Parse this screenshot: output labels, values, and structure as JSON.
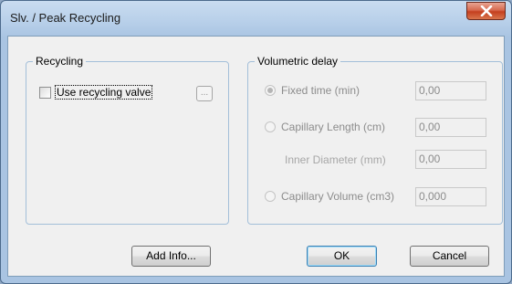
{
  "window": {
    "title": "Slv. / Peak Recycling"
  },
  "recycling": {
    "group_label": "Recycling",
    "checkbox_label": "Use recycling valve",
    "checkbox_checked": false,
    "browse_label": "..."
  },
  "volumetric": {
    "group_label": "Volumetric delay",
    "options": [
      {
        "label": "Fixed time (min)",
        "value": "0,00",
        "checked": true
      },
      {
        "label": "Capillary Length (cm)",
        "value": "0,00",
        "checked": false
      },
      {
        "label": "Capillary Volume (cm3)",
        "value": "0,000",
        "checked": false
      }
    ],
    "inner_diameter": {
      "label": "Inner Diameter (mm)",
      "value": "0,00"
    }
  },
  "buttons": {
    "add_info": "Add Info...",
    "ok": "OK",
    "cancel": "Cancel"
  },
  "colors": {
    "close_button": "#c4401f",
    "dialog_bg": "#f0f0f0",
    "group_border": "#a3bfd9"
  }
}
